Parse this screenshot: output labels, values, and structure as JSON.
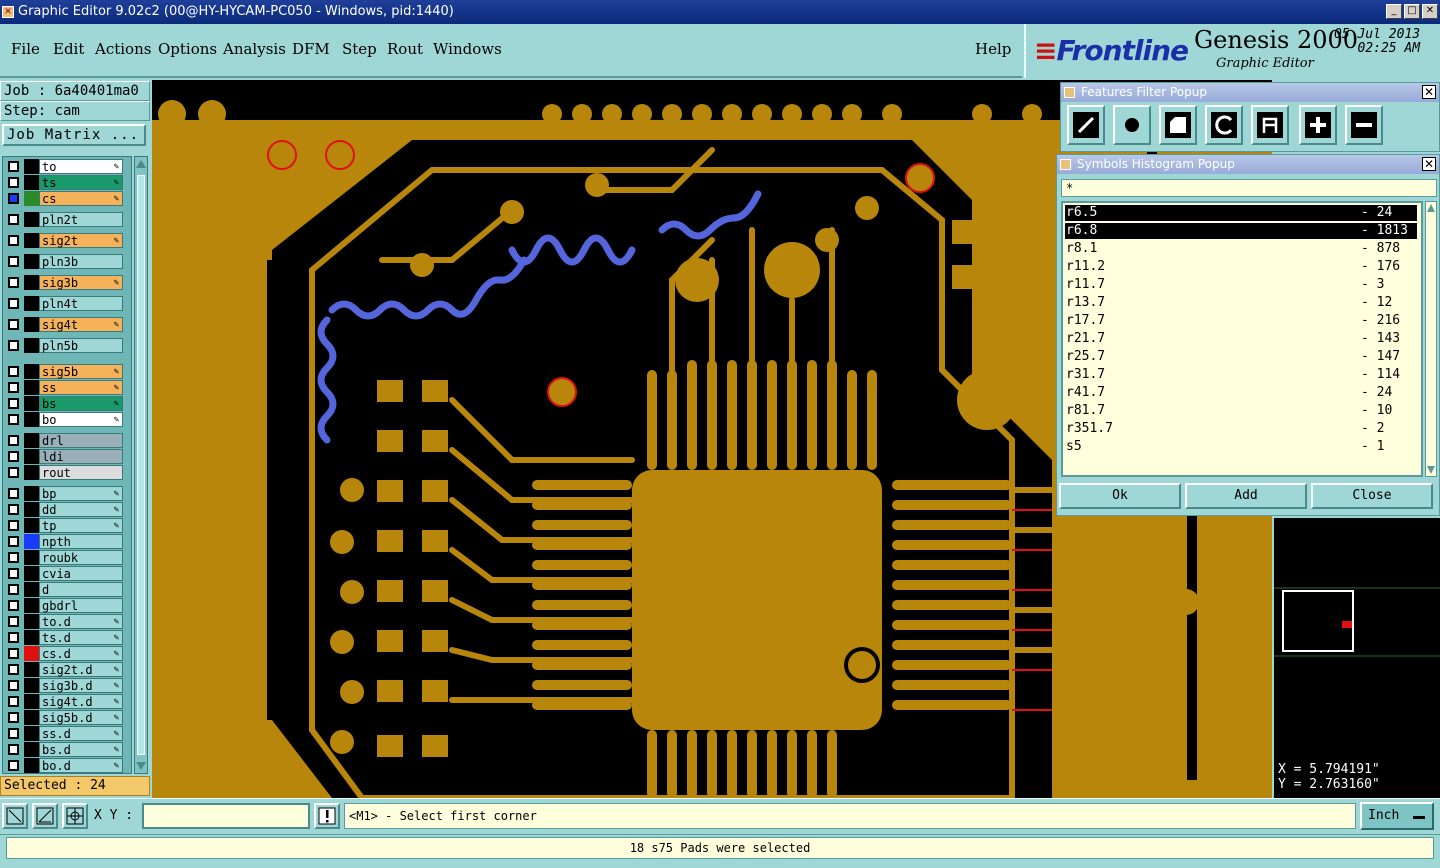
{
  "window": {
    "title": "Graphic Editor 9.02c2 (00@HY-HYCAM-PC050 - Windows, pid:1440)",
    "buttons": [
      "_",
      "□",
      "✕"
    ]
  },
  "menu": {
    "items": [
      "File",
      "Edit",
      "Actions",
      "Options",
      "Analysis",
      "DFM",
      "Step",
      "Rout",
      "Windows"
    ],
    "help": "Help"
  },
  "brand": {
    "logo": "Frontline",
    "product": "Genesis 2000",
    "subtitle": "Graphic Editor",
    "date": "05 Jul 2013",
    "time": "02:25 AM"
  },
  "job": {
    "job": "Job : 6a40401ma0",
    "step": "Step: cam",
    "matrix_button": "Job Matrix ..."
  },
  "layers": [
    {
      "name": "to",
      "color": "#ffffff",
      "checked": false,
      "swatch": "#000000",
      "editable": true
    },
    {
      "name": "ts",
      "color": "#1a9a6a",
      "checked": false,
      "swatch": "#000000",
      "editable": true
    },
    {
      "name": "cs",
      "color": "#f5b25a",
      "checked": true,
      "swatch": "#2a8a2a",
      "editable": true
    },
    {
      "name": "pln2t",
      "color": "#9fd6d6",
      "checked": false,
      "swatch": "#000000",
      "editable": false
    },
    {
      "name": "sig2t",
      "color": "#f5b25a",
      "checked": false,
      "swatch": "#000000",
      "editable": true
    },
    {
      "name": "pln3b",
      "color": "#9fd6d6",
      "checked": false,
      "swatch": "#000000",
      "editable": false
    },
    {
      "name": "sig3b",
      "color": "#f5b25a",
      "checked": false,
      "swatch": "#000000",
      "editable": true
    },
    {
      "name": "pln4t",
      "color": "#9fd6d6",
      "checked": false,
      "swatch": "#000000",
      "editable": false
    },
    {
      "name": "sig4t",
      "color": "#f5b25a",
      "checked": false,
      "swatch": "#000000",
      "editable": true
    },
    {
      "name": "pln5b",
      "color": "#9fd6d6",
      "checked": false,
      "swatch": "#000000",
      "editable": false
    },
    {
      "name": "sig5b",
      "color": "#f5b25a",
      "checked": false,
      "swatch": "#000000",
      "editable": true
    },
    {
      "name": "ss",
      "color": "#f5b25a",
      "checked": false,
      "swatch": "#000000",
      "editable": true
    },
    {
      "name": "bs",
      "color": "#1a9a6a",
      "checked": false,
      "swatch": "#000000",
      "editable": true
    },
    {
      "name": "bo",
      "color": "#ffffff",
      "checked": false,
      "swatch": "#000000",
      "editable": true
    },
    {
      "name": "drl",
      "color": "#9ab0b8",
      "checked": false,
      "swatch": "#000000",
      "editable": false
    },
    {
      "name": "ldi",
      "color": "#9ab0b8",
      "checked": false,
      "swatch": "#000000",
      "editable": false
    },
    {
      "name": "rout",
      "color": "#dcdcdc",
      "checked": false,
      "swatch": "#000000",
      "editable": false
    },
    {
      "name": "bp",
      "color": "#9fd6d6",
      "checked": false,
      "swatch": "#000000",
      "editable": true
    },
    {
      "name": "dd",
      "color": "#9fd6d6",
      "checked": false,
      "swatch": "#000000",
      "editable": true
    },
    {
      "name": "tp",
      "color": "#9fd6d6",
      "checked": false,
      "swatch": "#000000",
      "editable": true
    },
    {
      "name": "npth",
      "color": "#9fd6d6",
      "checked": false,
      "swatch": "#1a3aff",
      "editable": false
    },
    {
      "name": "roubk",
      "color": "#9fd6d6",
      "checked": false,
      "swatch": "#000000",
      "editable": false
    },
    {
      "name": "cvia",
      "color": "#9fd6d6",
      "checked": false,
      "swatch": "#000000",
      "editable": false
    },
    {
      "name": "d",
      "color": "#9fd6d6",
      "checked": false,
      "swatch": "#000000",
      "editable": false
    },
    {
      "name": "gbdrl",
      "color": "#9fd6d6",
      "checked": false,
      "swatch": "#000000",
      "editable": false
    },
    {
      "name": "to.d",
      "color": "#9fd6d6",
      "checked": false,
      "swatch": "#000000",
      "editable": true
    },
    {
      "name": "ts.d",
      "color": "#9fd6d6",
      "checked": false,
      "swatch": "#000000",
      "editable": true
    },
    {
      "name": "cs.d",
      "color": "#9fd6d6",
      "checked": false,
      "swatch": "#e01010",
      "editable": true
    },
    {
      "name": "sig2t.d",
      "color": "#9fd6d6",
      "checked": false,
      "swatch": "#000000",
      "editable": true
    },
    {
      "name": "sig3b.d",
      "color": "#9fd6d6",
      "checked": false,
      "swatch": "#000000",
      "editable": true
    },
    {
      "name": "sig4t.d",
      "color": "#9fd6d6",
      "checked": false,
      "swatch": "#000000",
      "editable": true
    },
    {
      "name": "sig5b.d",
      "color": "#9fd6d6",
      "checked": false,
      "swatch": "#000000",
      "editable": true
    },
    {
      "name": "ss.d",
      "color": "#9fd6d6",
      "checked": false,
      "swatch": "#000000",
      "editable": true
    },
    {
      "name": "bs.d",
      "color": "#9fd6d6",
      "checked": false,
      "swatch": "#000000",
      "editable": true
    },
    {
      "name": "bo.d",
      "color": "#9fd6d6",
      "checked": false,
      "swatch": "#000000",
      "editable": true
    }
  ],
  "selected": "Selected : 24",
  "features_popup": {
    "title": "Features Filter Popup"
  },
  "symbols_popup": {
    "title": "Symbols Histogram Popup",
    "filter": "*",
    "rows": [
      {
        "name": "r6.5",
        "count": "- 24",
        "highlighted": true
      },
      {
        "name": "r6.8",
        "count": "- 1813",
        "highlighted": true
      },
      {
        "name": "r8.1",
        "count": "- 878",
        "highlighted": false
      },
      {
        "name": "r11.2",
        "count": "- 176",
        "highlighted": false
      },
      {
        "name": "r11.7",
        "count": "- 3",
        "highlighted": false
      },
      {
        "name": "r13.7",
        "count": "- 12",
        "highlighted": false
      },
      {
        "name": "r17.7",
        "count": "- 216",
        "highlighted": false
      },
      {
        "name": "r21.7",
        "count": "- 143",
        "highlighted": false
      },
      {
        "name": "r25.7",
        "count": "- 147",
        "highlighted": false
      },
      {
        "name": "r31.7",
        "count": "- 114",
        "highlighted": false
      },
      {
        "name": "r41.7",
        "count": "- 24",
        "highlighted": false
      },
      {
        "name": "r81.7",
        "count": "- 10",
        "highlighted": false
      },
      {
        "name": "r351.7",
        "count": "- 2",
        "highlighted": false
      },
      {
        "name": "s5",
        "count": "- 1",
        "highlighted": false
      }
    ],
    "ok": "Ok",
    "add": "Add",
    "close": "Close"
  },
  "coords": {
    "x": "X = 5.794191\"",
    "y": "Y = 2.763160\""
  },
  "command": {
    "xy_label": "X Y :",
    "xy_value": "",
    "prompt": "<M1> - Select first corner",
    "unit": "Inch"
  },
  "status": "18 s75 Pads were selected",
  "colors": {
    "board": "#b8860b",
    "copper": "#000000",
    "accent_red": "#e01010",
    "via_blue": "#5566dd",
    "ui": "#9fd6d6"
  }
}
